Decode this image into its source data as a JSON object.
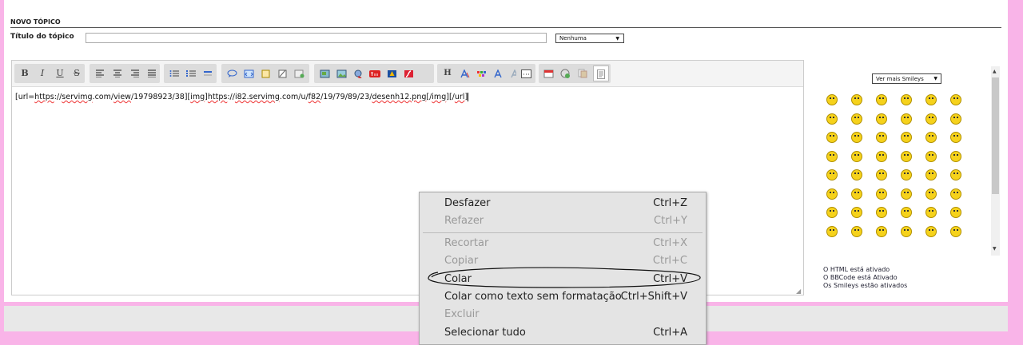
{
  "form": {
    "section_title": "NOVO TÓPICO",
    "title_label": "Título do tópico",
    "title_value": "",
    "icon_select_value": "Nenhuma"
  },
  "toolbar": {
    "buttons": [
      "bold-icon",
      "italic-icon",
      "underline-icon",
      "strike-icon",
      "align-left-icon",
      "align-center-icon",
      "align-right-icon",
      "justify-icon",
      "bullet-list-icon",
      "numbered-list-icon",
      "hr-icon",
      "quote-icon",
      "code-icon",
      "spoiler-icon",
      "hide-icon",
      "table-icon",
      "image-upload-icon",
      "image-host-icon",
      "link-icon",
      "youtube-icon",
      "dailymotion-icon",
      "flash-icon",
      "heading-icon",
      "font-size-icon",
      "color-icon",
      "font-face-icon",
      "clear-format-icon",
      "more-icon",
      "date-icon",
      "symbol-icon",
      "copy-icon",
      "source-icon"
    ],
    "bold_glyph": "B",
    "italic_glyph": "I",
    "underline_glyph": "U",
    "strike_glyph": "S",
    "heading_glyph": "H"
  },
  "editor": {
    "p1": "[url=",
    "p2": "https",
    "p3": "://",
    "p4": "servimg",
    "p5": ".com/",
    "p6": "view",
    "p7": "/19798923/38][",
    "p8": "img",
    "p9": "]",
    "p10": "https",
    "p11": "://",
    "p12": "i82.servimg",
    "p13": ".com/u/",
    "p14": "f82",
    "p15": "/19/79/89/23/",
    "p16": "desenh12.png",
    "p17": "[/",
    "p18": "img",
    "p19": "][/",
    "p20": "url",
    "p21": "]"
  },
  "smileys": {
    "select_label": "Ver mais Smileys",
    "count": 48
  },
  "status": {
    "html": "O HTML está ativado",
    "bbcode": "O BBCode está Ativado",
    "smileys": "Os Smileys estão ativados"
  },
  "context_menu": {
    "items": [
      {
        "label": "Desfazer",
        "shortcut": "Ctrl+Z",
        "enabled": true
      },
      {
        "label": "Refazer",
        "shortcut": "Ctrl+Y",
        "enabled": false
      },
      {
        "label": "Recortar",
        "shortcut": "Ctrl+X",
        "enabled": false
      },
      {
        "label": "Copiar",
        "shortcut": "Ctrl+C",
        "enabled": false
      },
      {
        "label": "Colar",
        "shortcut": "Ctrl+V",
        "enabled": true
      },
      {
        "label": "Colar como texto sem formatação",
        "shortcut": "Ctrl+Shift+V",
        "enabled": true
      },
      {
        "label": "Excluir",
        "shortcut": "",
        "enabled": false
      },
      {
        "label": "Selecionar tudo",
        "shortcut": "Ctrl+A",
        "enabled": true
      }
    ]
  },
  "colors": {
    "page_background": "#f9b4e8",
    "panel": "#ffffff",
    "menu_background": "#e4e4e4",
    "disabled_text": "#9a9a9a",
    "smiley": "#f6d21b"
  }
}
